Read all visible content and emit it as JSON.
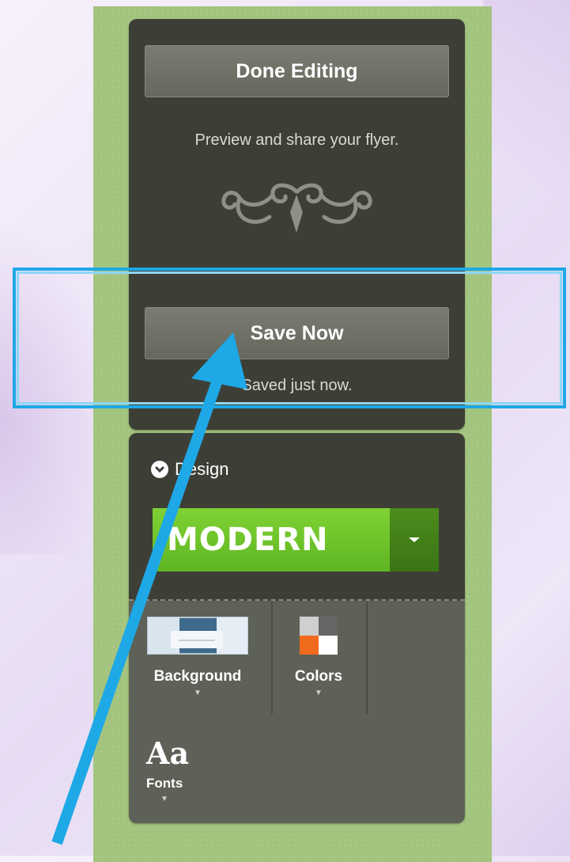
{
  "done_panel": {
    "button_label": "Done Editing",
    "subtext": "Preview and share your flyer."
  },
  "save_panel": {
    "button_label": "Save Now",
    "status": "Saved just now."
  },
  "design_panel": {
    "label": "Design",
    "selected_design": "MODERN",
    "tools": [
      {
        "label": "Background",
        "icon": "background-icon"
      },
      {
        "label": "Colors",
        "icon": "colors-icon"
      },
      {
        "label": "Fonts",
        "icon": "fonts-icon",
        "glyph": "Aa"
      }
    ]
  },
  "annotation": {
    "highlight_color": "#1ea8e6",
    "arrow_color": "#1ea8e6"
  }
}
